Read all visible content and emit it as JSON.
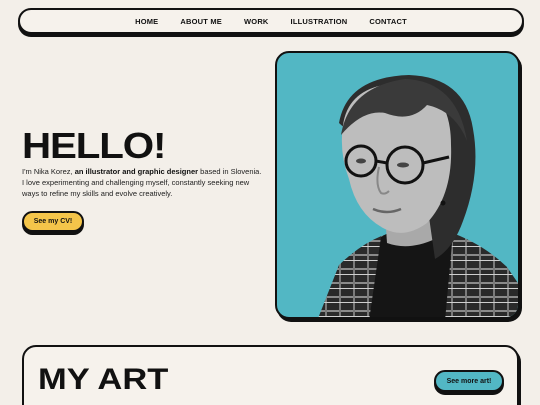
{
  "nav": {
    "items": [
      "HOME",
      "ABOUT ME",
      "WORK",
      "ILLUSTRATION",
      "CONTACT"
    ]
  },
  "hero": {
    "heading": "HELLO!",
    "intro_before": "I'm Nika Korez, ",
    "intro_bold": "an illustrator and graphic designer",
    "intro_after": " based in Slovenia. I love experimenting and challenging myself, constantly seeking new ways to refine my skills and evolve creatively.",
    "cv_button": "See my CV!"
  },
  "portrait": {
    "background_color": "#52b7c4",
    "icon": "portrait-photo"
  },
  "art": {
    "title": "MY ART",
    "more_button": "See more art!"
  },
  "colors": {
    "accent_yellow": "#f4c54a",
    "accent_teal": "#52b7c4",
    "background": "#f3efe9"
  }
}
